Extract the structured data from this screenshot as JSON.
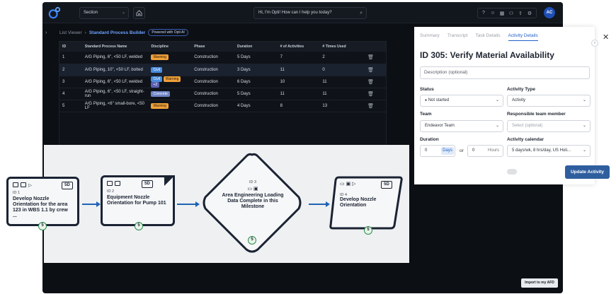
{
  "topbar": {
    "section_label": "Section",
    "ask_placeholder": "Hi, I'm Opti! How can I help you today?",
    "avatar_initials": "AC"
  },
  "breadcrumb": {
    "parent": "List Viewer",
    "current": "Standard Process Builder",
    "badge": "Powered with Opti AI"
  },
  "table": {
    "headers": [
      "ID",
      "Standard Process Name",
      "Discipline",
      "Phase",
      "Duration",
      "# of Activities",
      "# Times Used"
    ],
    "rows": [
      {
        "id": "1",
        "name": "A/G Piping, 6\", <50 LF, welded",
        "tags": [
          "Warning"
        ],
        "phase": "Construction",
        "duration": "5 Days",
        "activities": "7",
        "used": "2"
      },
      {
        "id": "2",
        "name": "A/G Piping, 10\", <50 LF, bolted",
        "tags": [
          "Civil"
        ],
        "phase": "Construction",
        "duration": "3 Days",
        "activities": "11",
        "used": "0"
      },
      {
        "id": "3",
        "name": "A/G Piping, 6\", <50 LF, welded",
        "tags": [
          "Civil",
          "Warning",
          "+2"
        ],
        "phase": "Construction",
        "duration": "6 Days",
        "activities": "10",
        "used": "11"
      },
      {
        "id": "4",
        "name": "A/G Piping, 6\", <50 LF, straight-run",
        "tags": [
          "Concrete"
        ],
        "phase": "Construction",
        "duration": "5 Days",
        "activities": "11",
        "used": "11"
      },
      {
        "id": "5",
        "name": "A/G Piping, <6\" small-bore, <50 LF",
        "tags": [
          "Warning"
        ],
        "phase": "Construction",
        "duration": "4 Days",
        "activities": "8",
        "used": "13"
      }
    ]
  },
  "import_button": "Import to my AFD",
  "diagram": {
    "nodes": [
      {
        "id": "ID 1",
        "title": "Develop Nozzle Orientation for the area 123 in WBS 1.1 by crew ...",
        "duration": "5D",
        "badge": "5"
      },
      {
        "id": "ID 2",
        "title": "Equipment Nozzle Orientation for Pump 101",
        "duration": "5D",
        "badge": "5"
      },
      {
        "id": "ID 3",
        "title": "Area Engineering Loading Data Complete in this Milestone",
        "badge": "5"
      },
      {
        "id": "ID 4",
        "title": "Develop Nozzle Orientation",
        "duration": "5D",
        "badge": "5"
      }
    ]
  },
  "panel": {
    "tabs": [
      "Summary",
      "Transcript",
      "Task Details",
      "Activity Details"
    ],
    "title": "ID 305: Verify Material Availability",
    "description_placeholder": "Description (optional)",
    "status_label": "Status",
    "status_value": "Not started",
    "activity_type_label": "Activity Type",
    "activity_type_value": "Activity",
    "team_label": "Team",
    "team_value": "Endeavor Team",
    "responsible_label": "Responsible team member",
    "responsible_placeholder": "Select (optional)",
    "duration_label": "Duration",
    "duration_days": "0",
    "duration_days_unit": "Days",
    "or_text": "or",
    "duration_hours": "0",
    "duration_hours_unit": "Hours",
    "calendar_label": "Activity calendar",
    "calendar_value": "5 days/wk, 8 hrs/day, US Holi...",
    "update_button": "Update Activity"
  }
}
